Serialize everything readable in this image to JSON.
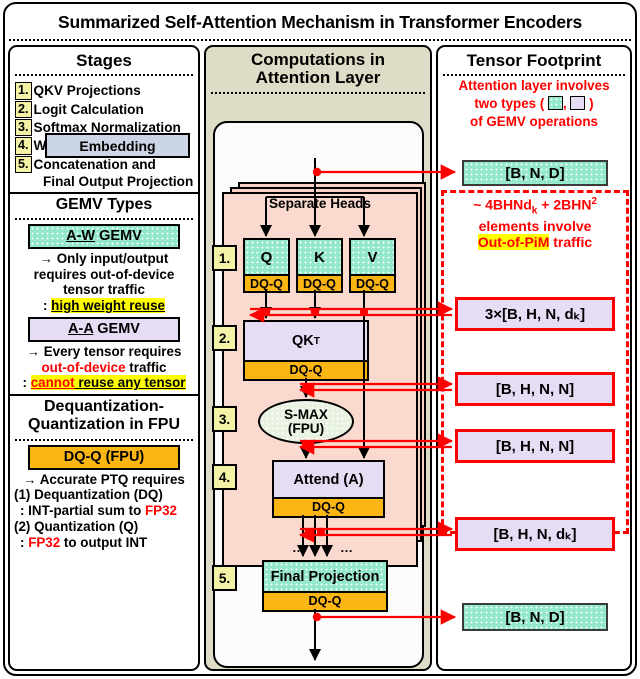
{
  "title": "Summarized Self-Attention Mechanism in Transformer Encoders",
  "left_column": {
    "stages_heading": "Stages",
    "stages": [
      {
        "num": "1.",
        "text": "QKV Projections"
      },
      {
        "num": "2.",
        "text": "Logit Calculation"
      },
      {
        "num": "3.",
        "text": "Softmax Normalization"
      },
      {
        "num": "4.",
        "text": "Weighted Sum of V"
      },
      {
        "num": "5.",
        "text": "Concatenation and"
      }
    ],
    "stage5_cont": "Final Output Projection",
    "gemv_heading": "GEMV Types",
    "aw_chip": "A-W GEMV",
    "aw_chip_underline": "A-W",
    "aw_line1": "→ Only input/output",
    "aw_line2": "requires out-of-device",
    "aw_line3": "tensor traffic",
    "aw_line4_prefix": ": ",
    "aw_line4_hl": "high weight reuse",
    "aa_chip": "A-A GEMV",
    "aa_chip_underline": "A-A",
    "aa_line1": "→ Every tensor requires",
    "aa_line2_red": "out-of-device",
    "aa_line2_rest": " traffic",
    "aa_line3_prefix": ": ",
    "aa_line3_red_hl": "cannot",
    "aa_line3_hl": " reuse any tensor",
    "dq_heading_l1": "Dequantization-",
    "dq_heading_l2": "Quantization in FPU",
    "dq_chip": "DQ-Q (FPU)",
    "dq_line1": "→ Accurate PTQ requires",
    "dq_line2": "(1) Dequantization (DQ)",
    "dq_line3_prefix": ": INT-partial sum to ",
    "dq_line3_red": "FP32",
    "dq_line4": "(2) Quantization (Q)",
    "dq_line5_prefix": ": ",
    "dq_line5_red": "FP32",
    "dq_line5_rest": " to output INT"
  },
  "middle_column": {
    "heading_l1": "Computations in",
    "heading_l2": "Attention Layer",
    "embedding": "Embedding",
    "separate_heads": "Separate Heads",
    "q": "Q",
    "k": "K",
    "v": "V",
    "dqq": "DQ-Q",
    "qk": "QK",
    "qk_sup": "T",
    "smax_l1": "S-MAX",
    "smax_l2": "(FPU)",
    "attend": "Attend (A)",
    "final_projection": "Final Projection",
    "ellipsis_left": "…",
    "ellipsis_right": "…",
    "stage_tags": [
      "1.",
      "2.",
      "3.",
      "4.",
      "5."
    ]
  },
  "right_column": {
    "heading": "Tensor Footprint",
    "note_l1": "Attention layer involves",
    "note_l2_a": "two types ( ",
    "note_l2_b": ", ",
    "note_l2_c": " )",
    "note_l3": "of GEMV operations",
    "top_tensor": "[B, N, D]",
    "pim_l1_a": "~ 4BHNd",
    "pim_l1_sub": "k",
    "pim_l1_b": " + 2BHN",
    "pim_l1_sup": "2",
    "pim_l2": "elements involve",
    "pim_l3_hl": "Out-of-PiM",
    "pim_l3_rest": " traffic",
    "tensors": [
      "3×[B, H, N, dₖ]",
      "[B, H, N, N]",
      "[B, H, N, N]",
      "[B, H, N, dₖ]"
    ],
    "bottom_tensor": "[B, N, D]"
  },
  "colors": {
    "mint": "#92e8c8",
    "lavender": "#e6dcf4",
    "orange": "#fcb614",
    "yellow_tag": "#f4f2a6",
    "highlight": "#ffff00",
    "red": "#ff0000",
    "beige": "#dedcc6",
    "salmon": "#fad9ce",
    "embedding_blue": "#ccd5e5"
  }
}
